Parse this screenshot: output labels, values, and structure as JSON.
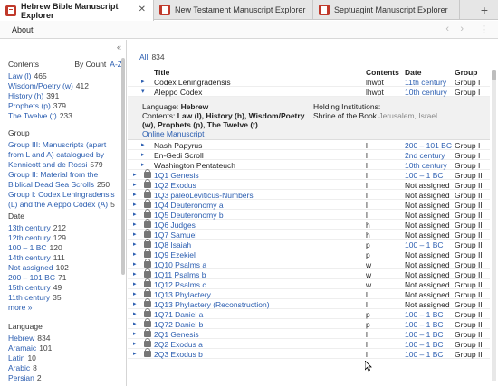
{
  "tabs": [
    {
      "label": "Hebrew Bible Manuscript Explorer",
      "active": true,
      "close": "✕"
    },
    {
      "label": "New Testament Manuscript Explorer",
      "active": false
    },
    {
      "label": "Septuagint Manuscript Explorer",
      "active": false
    }
  ],
  "tab_add": "+",
  "menu": {
    "about": "About",
    "back": "‹",
    "forward": "›",
    "more": "⋮"
  },
  "sidebar": {
    "collapse": "«",
    "contents": {
      "title": "Contents",
      "sort_by": "By Count",
      "sort_az": "A-Z",
      "items": [
        {
          "label": "Law (l)",
          "count": "465"
        },
        {
          "label": "Wisdom/Poetry (w)",
          "count": "412"
        },
        {
          "label": "History (h)",
          "count": "391"
        },
        {
          "label": "Prophets (p)",
          "count": "379"
        },
        {
          "label": "The Twelve (t)",
          "count": "233"
        }
      ]
    },
    "group": {
      "title": "Group",
      "items": [
        {
          "label": "Group III: Manuscripts (apart from L and A) catalogued by Kennicott and de Rossi",
          "count": "579"
        },
        {
          "label": "Group II: Material from the Biblical Dead Sea Scrolls",
          "count": "250"
        },
        {
          "label": "Group I: Codex Leningradensis (L) and the Aleppo Codex (A)",
          "count": "5"
        }
      ]
    },
    "date": {
      "title": "Date",
      "items": [
        {
          "label": "13th century",
          "count": "212"
        },
        {
          "label": "12th century",
          "count": "129"
        },
        {
          "label": "100 – 1 BC",
          "count": "120"
        },
        {
          "label": "14th century",
          "count": "111"
        },
        {
          "label": "Not assigned",
          "count": "102"
        },
        {
          "label": "200 – 101 BC",
          "count": "71"
        },
        {
          "label": "15th century",
          "count": "49"
        },
        {
          "label": "11th century",
          "count": "35"
        }
      ],
      "more": "more »"
    },
    "language": {
      "title": "Language",
      "items": [
        {
          "label": "Hebrew",
          "count": "834"
        },
        {
          "label": "Aramaic",
          "count": "101"
        },
        {
          "label": "Latin",
          "count": "10"
        },
        {
          "label": "Arabic",
          "count": "8"
        },
        {
          "label": "Persian",
          "count": "2"
        }
      ]
    }
  },
  "main": {
    "all_label": "All",
    "all_count": "834",
    "columns": {
      "title": "Title",
      "contents": "Contents",
      "date": "Date",
      "group": "Group"
    },
    "rows_top": [
      {
        "caret": "▸",
        "title": "Codex Leningradensis",
        "contents": "lhwpt",
        "date": "11th century",
        "group": "Group I",
        "lock": false
      },
      {
        "caret": "▾",
        "title": "Aleppo Codex",
        "contents": "lhwpt",
        "date": "10th century",
        "group": "Group I",
        "lock": false
      }
    ],
    "detail": {
      "language_label": "Language:",
      "language_value": "Hebrew",
      "contents_label": "Contents:",
      "contents_value": "Law (l), History (h), Wisdom/Poetry (w), Prophets (p), The Twelve (t)",
      "online": "Online Manuscript",
      "holding_label": "Holding Institutions:",
      "holding_value": "Shrine of the Book",
      "holding_place": "Jerusalem, Israel"
    },
    "rows": [
      {
        "caret": "▸",
        "title": "Nash Papyrus",
        "contents": "l",
        "date": "200 – 101 BC",
        "group": "Group I",
        "lock": false,
        "linked": false,
        "date_na": false
      },
      {
        "caret": "▸",
        "title": "En-Gedi Scroll",
        "contents": "l",
        "date": "2nd century",
        "group": "Group I",
        "lock": false,
        "linked": false,
        "date_na": false
      },
      {
        "caret": "▸",
        "title": "Washington Pentateuch",
        "contents": "l",
        "date": "10th century",
        "group": "Group I",
        "lock": false,
        "linked": false,
        "date_na": false
      },
      {
        "caret": "▸",
        "title": "1Q1 Genesis",
        "contents": "l",
        "date": "100 – 1 BC",
        "group": "Group II",
        "lock": true,
        "linked": true,
        "date_na": false
      },
      {
        "caret": "▸",
        "title": "1Q2 Exodus",
        "contents": "l",
        "date": "Not assigned",
        "group": "Group II",
        "lock": true,
        "linked": true,
        "date_na": true
      },
      {
        "caret": "▸",
        "title": "1Q3 paleoLeviticus-Numbers",
        "contents": "l",
        "date": "Not assigned",
        "group": "Group II",
        "lock": true,
        "linked": true,
        "date_na": true
      },
      {
        "caret": "▸",
        "title": "1Q4 Deuteronomy a",
        "contents": "l",
        "date": "Not assigned",
        "group": "Group II",
        "lock": true,
        "linked": true,
        "date_na": true
      },
      {
        "caret": "▸",
        "title": "1Q5 Deuteronomy b",
        "contents": "l",
        "date": "Not assigned",
        "group": "Group II",
        "lock": true,
        "linked": true,
        "date_na": true
      },
      {
        "caret": "▸",
        "title": "1Q6 Judges",
        "contents": "h",
        "date": "Not assigned",
        "group": "Group II",
        "lock": true,
        "linked": true,
        "date_na": true
      },
      {
        "caret": "▸",
        "title": "1Q7 Samuel",
        "contents": "h",
        "date": "Not assigned",
        "group": "Group II",
        "lock": true,
        "linked": true,
        "date_na": true
      },
      {
        "caret": "▸",
        "title": "1Q8 Isaiah",
        "contents": "p",
        "date": "100 – 1 BC",
        "group": "Group II",
        "lock": true,
        "linked": true,
        "date_na": false
      },
      {
        "caret": "▸",
        "title": "1Q9 Ezekiel",
        "contents": "p",
        "date": "Not assigned",
        "group": "Group II",
        "lock": true,
        "linked": true,
        "date_na": true
      },
      {
        "caret": "▸",
        "title": "1Q10 Psalms a",
        "contents": "w",
        "date": "Not assigned",
        "group": "Group II",
        "lock": true,
        "linked": true,
        "date_na": true
      },
      {
        "caret": "▸",
        "title": "1Q11 Psalms b",
        "contents": "w",
        "date": "Not assigned",
        "group": "Group II",
        "lock": true,
        "linked": true,
        "date_na": true
      },
      {
        "caret": "▸",
        "title": "1Q12 Psalms c",
        "contents": "w",
        "date": "Not assigned",
        "group": "Group II",
        "lock": true,
        "linked": true,
        "date_na": true
      },
      {
        "caret": "▸",
        "title": "1Q13 Phylactery",
        "contents": "l",
        "date": "Not assigned",
        "group": "Group II",
        "lock": true,
        "linked": true,
        "date_na": true
      },
      {
        "caret": "▸",
        "title": "1Q13 Phylactery (Reconstruction)",
        "contents": "l",
        "date": "Not assigned",
        "group": "Group II",
        "lock": true,
        "linked": true,
        "date_na": true
      },
      {
        "caret": "▸",
        "title": "1Q71 Daniel a",
        "contents": "p",
        "date": "100 – 1 BC",
        "group": "Group II",
        "lock": true,
        "linked": true,
        "date_na": false
      },
      {
        "caret": "▸",
        "title": "1Q72 Daniel b",
        "contents": "p",
        "date": "100 – 1 BC",
        "group": "Group II",
        "lock": true,
        "linked": true,
        "date_na": false
      },
      {
        "caret": "▸",
        "title": "2Q1 Genesis",
        "contents": "l",
        "date": "100 – 1 BC",
        "group": "Group II",
        "lock": true,
        "linked": true,
        "date_na": false
      },
      {
        "caret": "▸",
        "title": "2Q2 Exodus a",
        "contents": "l",
        "date": "100 – 1 BC",
        "group": "Group II",
        "lock": true,
        "linked": true,
        "date_na": false
      },
      {
        "caret": "▸",
        "title": "2Q3 Exodus b",
        "contents": "l",
        "date": "100 – 1 BC",
        "group": "Group II",
        "lock": true,
        "linked": true,
        "date_na": false
      }
    ]
  },
  "colors": {
    "link": "#2a5db0",
    "detail_bg": "#f1f1f1",
    "tabbar_bg": "#e6e6e6"
  }
}
